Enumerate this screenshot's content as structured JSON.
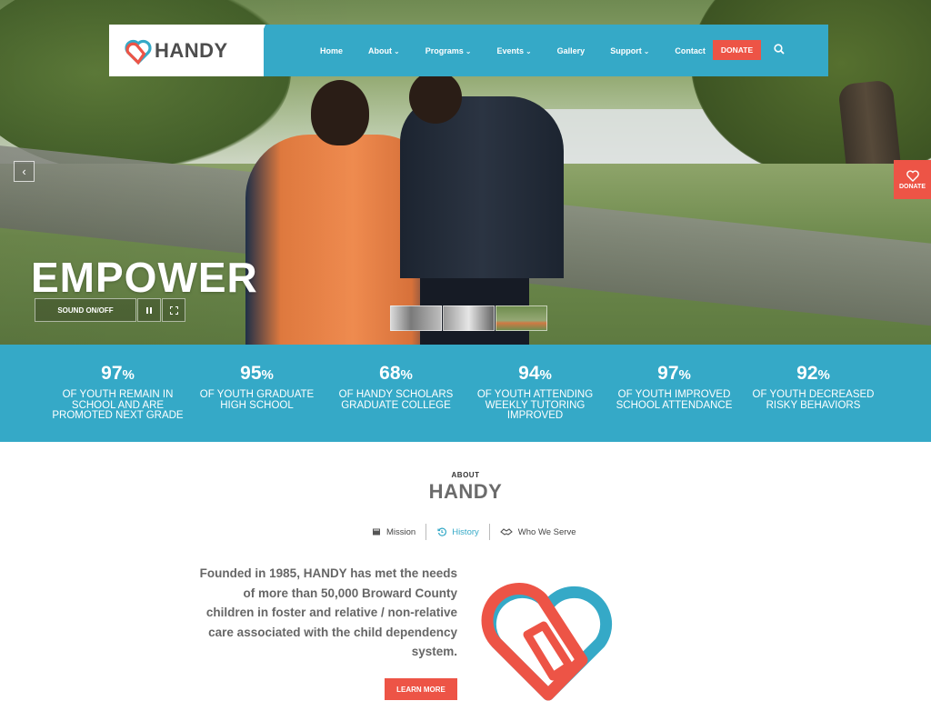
{
  "brand": {
    "name": "HANDY",
    "red": "#ed5446",
    "blue": "#35a9c7"
  },
  "nav": {
    "items": [
      {
        "label": "Home",
        "dropdown": false
      },
      {
        "label": "About",
        "dropdown": true
      },
      {
        "label": "Programs",
        "dropdown": true
      },
      {
        "label": "Events",
        "dropdown": true
      },
      {
        "label": "Gallery",
        "dropdown": false
      },
      {
        "label": "Support",
        "dropdown": true
      },
      {
        "label": "Contact",
        "dropdown": false
      }
    ],
    "donate_label": "DONATE",
    "search_icon": "search-icon"
  },
  "hero": {
    "title": "EMPOWER",
    "sound_label": "SOUND ON/OFF",
    "pause_icon": "pause-icon",
    "expand_icon": "expand-icon",
    "prev_icon": "chevron-left-icon",
    "side_donate_label": "DONATE"
  },
  "stats": [
    {
      "value": "97",
      "suffix": "%",
      "desc": "OF YOUTH REMAIN IN SCHOOL AND ARE PROMOTED NEXT GRADE"
    },
    {
      "value": "95",
      "suffix": "%",
      "desc": "OF YOUTH GRADUATE HIGH SCHOOL"
    },
    {
      "value": "68",
      "suffix": "%",
      "desc": "OF HANDY SCHOLARS GRADUATE COLLEGE"
    },
    {
      "value": "94",
      "suffix": "%",
      "desc": "OF YOUTH ATTENDING WEEKLY TUTORING IMPROVED"
    },
    {
      "value": "97",
      "suffix": "%",
      "desc": "OF YOUTH IMPROVED SCHOOL ATTENDANCE"
    },
    {
      "value": "92",
      "suffix": "%",
      "desc": "OF YOUTH DECREASED RISKY BEHAVIORS"
    }
  ],
  "about": {
    "kicker": "ABOUT",
    "title": "HANDY",
    "tabs": [
      {
        "label": "Mission",
        "icon": "book-icon",
        "active": false
      },
      {
        "label": "History",
        "icon": "history-icon",
        "active": true
      },
      {
        "label": "Who We Serve",
        "icon": "handshake-icon",
        "active": false
      }
    ],
    "text": "Founded in 1985, HANDY has met the needs of more than 50,000 Broward County children in foster and relative / non-relative care associated with the child dependency system.",
    "button_label": "LEARN MORE"
  }
}
